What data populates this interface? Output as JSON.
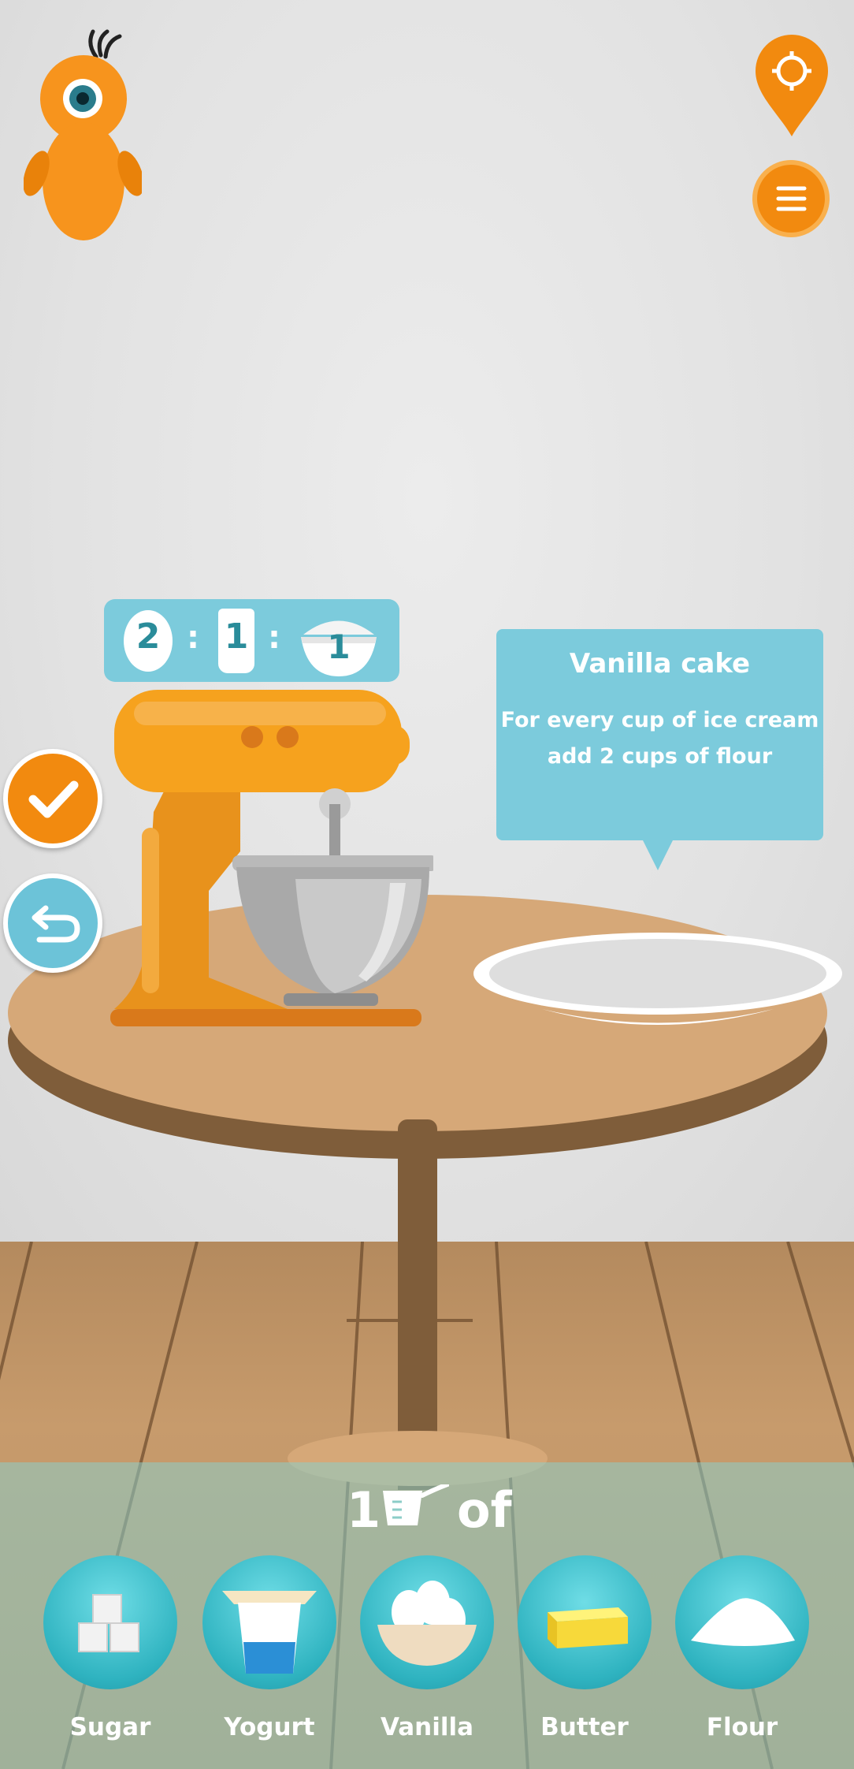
{
  "ratio": {
    "first": "2",
    "second": "1",
    "third": "1",
    "separator": ":"
  },
  "tooltip": {
    "title": "Vanilla cake",
    "body_line1": "For every cup of ice cream",
    "body_line2": "add 2 cups of flour"
  },
  "measure": {
    "amount": "1",
    "unit_icon": "measuring-cup-icon",
    "suffix": "of"
  },
  "ingredients": [
    {
      "label": "Sugar",
      "icon": "sugar-cubes-icon"
    },
    {
      "label": "Yogurt",
      "icon": "yogurt-cup-icon"
    },
    {
      "label": "Vanilla",
      "icon": "eggs-bowl-icon"
    },
    {
      "label": "Butter",
      "icon": "butter-icon"
    },
    {
      "label": "Flour",
      "icon": "flour-pile-icon"
    }
  ],
  "colors": {
    "accent_orange": "#f28a0f",
    "teal_panel": "#7ccbdc",
    "confirm": "#f7941d",
    "undo": "#6cc3d8"
  }
}
